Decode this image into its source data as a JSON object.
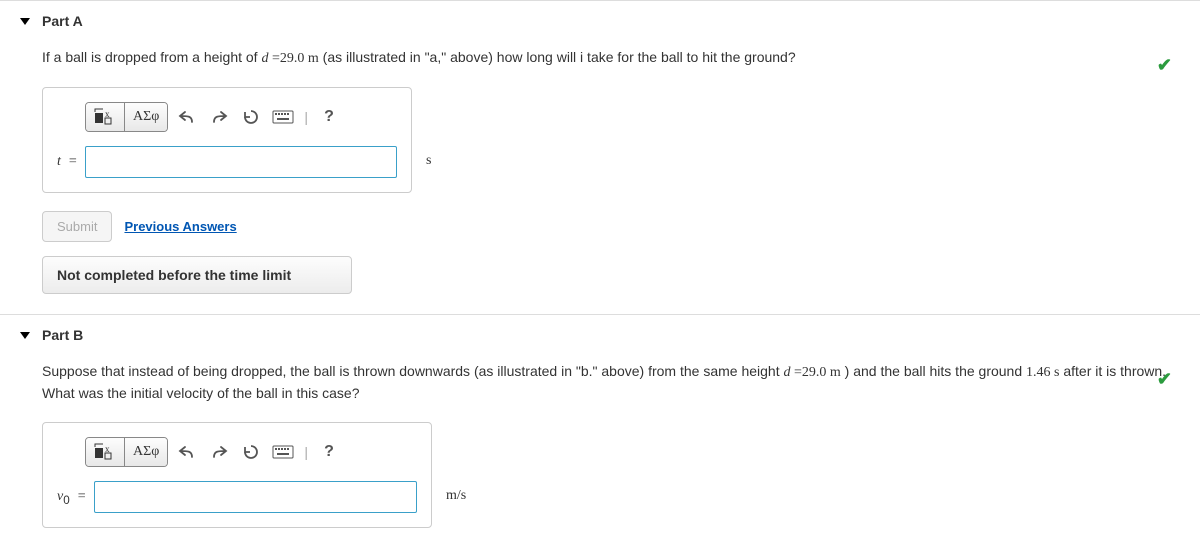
{
  "parts": [
    {
      "title": "Part A",
      "question_pre": "If a ball is dropped from a height of ",
      "d_sym": "d",
      "eq": " =",
      "d_val": "29.0 m",
      "question_post": " (as illustrated in \"a,\" above) how long will i take for the ball to hit the ground?",
      "var": "t",
      "var_eq": " = ",
      "unit": "s",
      "value": "",
      "submit": "Submit",
      "prev": "Previous Answers",
      "msg": "Not completed before the time limit",
      "check": "✔"
    },
    {
      "title": "Part B",
      "q1": "Suppose that instead of being dropped, the ball is thrown downwards (as illustrated in \"b.\" above) from the same height ",
      "d_sym": "d",
      "eq": " =",
      "d_val": "29.0 m",
      "q2": " ) and the ball hits the ground ",
      "t_val": "1.46 s",
      "q3": "  after it is thrown. What was the initial velocity of the ball in this case?",
      "var": "v",
      "var_sub": "0",
      "var_eq": " = ",
      "unit": "m/s",
      "value": "",
      "check": "✔"
    }
  ],
  "toolbar": {
    "greek": "ΑΣφ",
    "help": "?"
  }
}
